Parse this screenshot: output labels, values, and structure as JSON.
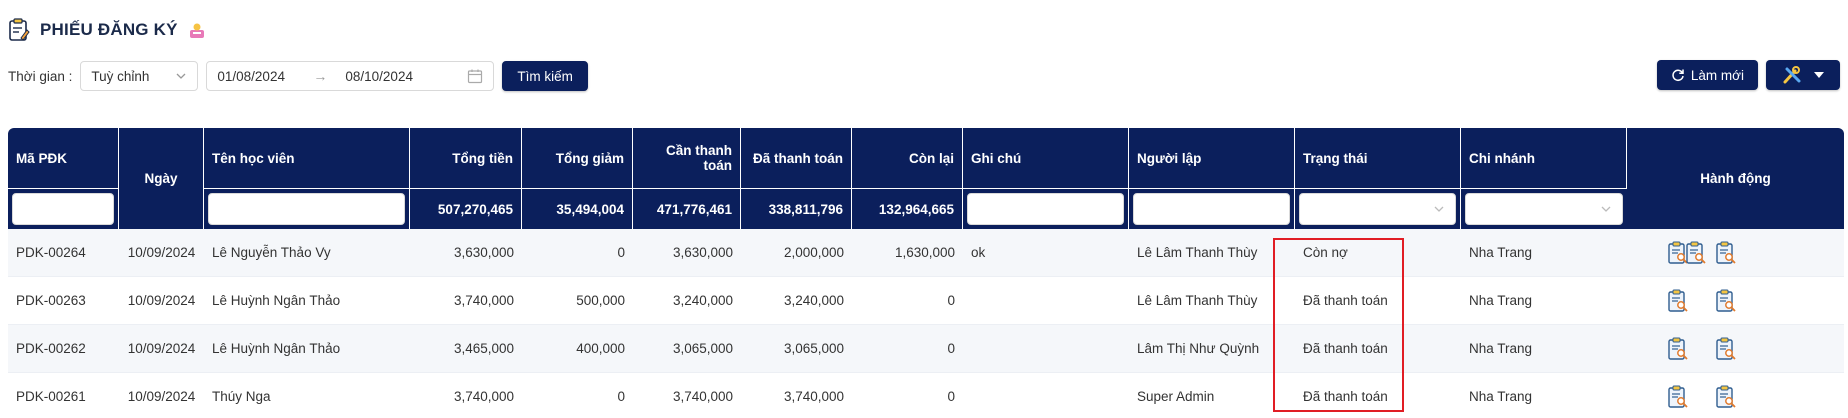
{
  "page": {
    "title": "PHIẾU ĐĂNG KÝ",
    "title_icon": "clipboard-edit-icon",
    "badge_icon": "user-badge-icon"
  },
  "filters": {
    "time_label": "Thời gian :",
    "period_select": "Tuỳ chỉnh",
    "date_from": "01/08/2024",
    "date_to": "08/10/2024",
    "search_label": "Tìm kiếm"
  },
  "toolbar": {
    "refresh_label": "Làm mới",
    "refresh_icon": "refresh-icon",
    "tools_icon": "tools-icon"
  },
  "colors": {
    "header_bg": "#0b1f5c",
    "highlight": "#e11d24"
  },
  "table": {
    "headers": {
      "code": "Mã PĐK",
      "date": "Ngày",
      "student": "Tên học viên",
      "total": "Tổng tiền",
      "discount": "Tổng giảm",
      "due_line1": "Cần thanh",
      "due_line2": "toán",
      "paid": "Đã thanh toán",
      "remaining": "Còn lại",
      "note": "Ghi chú",
      "creator": "Người lập",
      "status": "Trạng thái",
      "branch": "Chi nhánh",
      "actions": "Hành động"
    },
    "totals": {
      "total": "507,270,465",
      "discount": "35,494,004",
      "due": "471,776,461",
      "paid": "338,811,796",
      "remaining": "132,964,665"
    },
    "rows": [
      {
        "code": "PDK-00264",
        "date": "10/09/2024",
        "student": "Lê Nguyễn Thảo Vy",
        "total": "3,630,000",
        "discount": "0",
        "due": "3,630,000",
        "paid": "2,000,000",
        "remaining": "1,630,000",
        "note": "ok",
        "creator": "Lê Lâm Thanh Thùy",
        "status": "Còn nợ",
        "branch": "Nha Trang"
      },
      {
        "code": "PDK-00263",
        "date": "10/09/2024",
        "student": "Lê Huỳnh Ngân Thảo",
        "total": "3,740,000",
        "discount": "500,000",
        "due": "3,240,000",
        "paid": "3,240,000",
        "remaining": "0",
        "note": "",
        "creator": "Lê Lâm Thanh Thùy",
        "status": "Đã thanh toán",
        "branch": "Nha Trang"
      },
      {
        "code": "PDK-00262",
        "date": "10/09/2024",
        "student": "Lê Huỳnh Ngân Thảo",
        "total": "3,465,000",
        "discount": "400,000",
        "due": "3,065,000",
        "paid": "3,065,000",
        "remaining": "0",
        "note": "",
        "creator": "Lâm Thị Như Quỳnh",
        "status": "Đã thanh toán",
        "branch": "Nha Trang"
      },
      {
        "code": "PDK-00261",
        "date": "10/09/2024",
        "student": "Thúy Nga",
        "total": "3,740,000",
        "discount": "0",
        "due": "3,740,000",
        "paid": "3,740,000",
        "remaining": "0",
        "note": "",
        "creator": "Super Admin",
        "status": "Đã thanh toán",
        "branch": "Nha Trang"
      }
    ]
  }
}
